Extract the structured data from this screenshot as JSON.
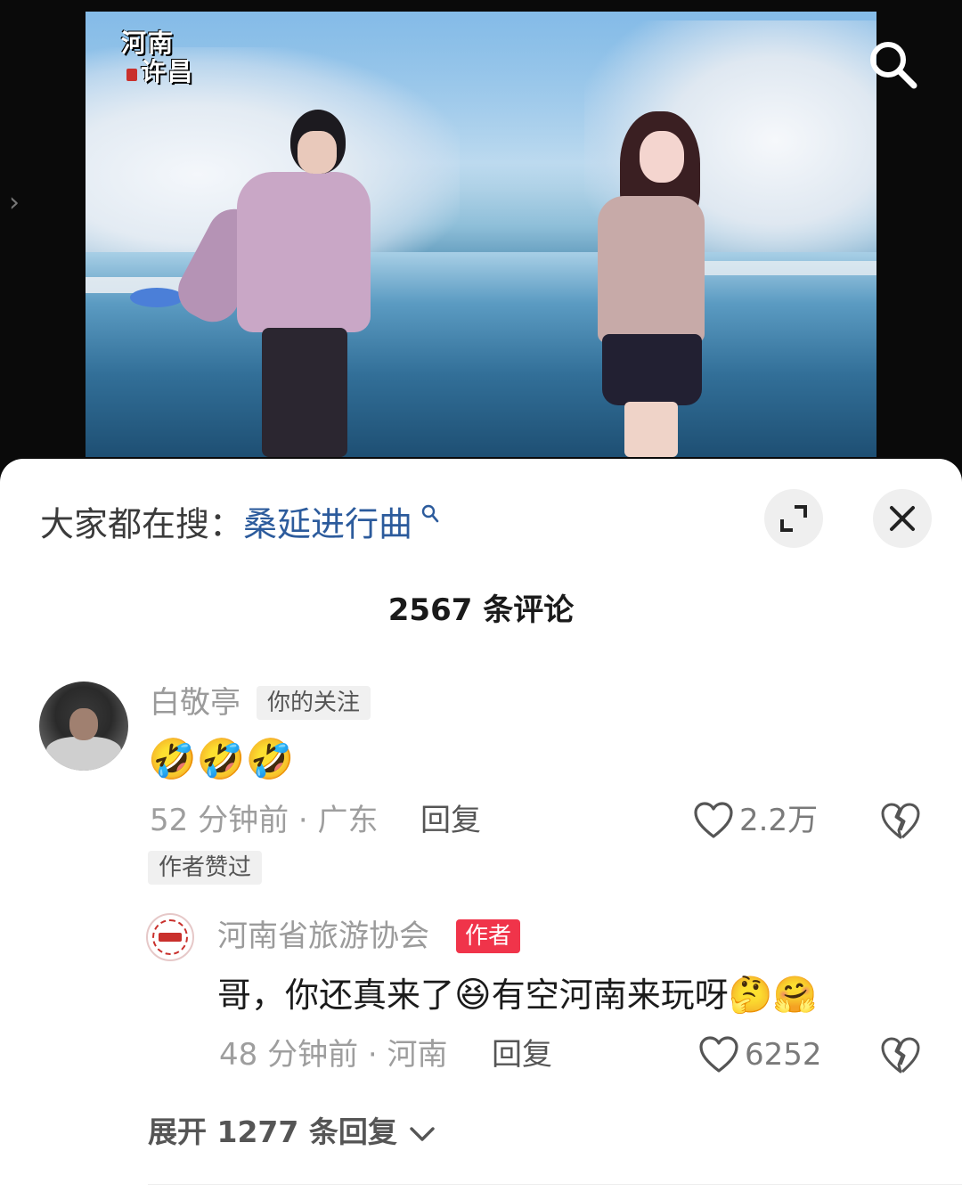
{
  "video": {
    "watermark_line1": "河南",
    "watermark_line2": "许昌"
  },
  "icons": {
    "search": "search-icon",
    "side_arrow": "chevron-right-icon",
    "expand": "expand-icon",
    "close": "close-icon",
    "like": "heart-icon",
    "dislike": "broken-heart-icon",
    "expand_replies": "chevron-down-icon"
  },
  "sheet": {
    "hot_search_label": "大家都在搜：",
    "hot_search_term": "桑延进行曲",
    "comment_count": "2567 条评论"
  },
  "comment": {
    "username": "白敬亭",
    "follow_tag": "你的关注",
    "text": "🤣🤣🤣",
    "meta": "52 分钟前 · 广东",
    "reply": "回复",
    "likes": "2.2万",
    "author_liked_tag": "作者赞过"
  },
  "reply": {
    "username": "河南省旅游协会",
    "author_tag": "作者",
    "text_part1": "哥，你还真来了",
    "emoji1": "😆",
    "text_part2": "有空河南来玩呀",
    "emoji2": "🤔🤗",
    "meta": "48 分钟前 · 河南",
    "reply": "回复",
    "likes": "6252"
  },
  "expand_replies": "展开 1277 条回复",
  "colors": {
    "hot_term": "#2c5b9c",
    "author_tag": "#f0344a",
    "sheet_bg": "#ffffff",
    "muted_text": "#9e9e9e"
  }
}
